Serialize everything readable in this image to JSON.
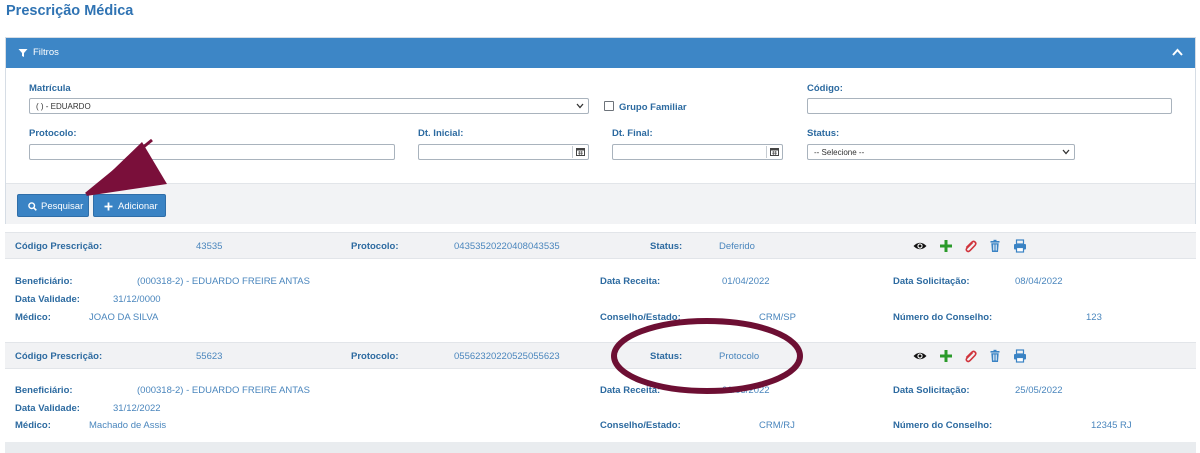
{
  "page": {
    "title": "Prescrição Médica"
  },
  "filters": {
    "title": "Filtros",
    "matricula": {
      "label": "Matrícula",
      "value": "(          ) - EDUARDO"
    },
    "grupo_familiar": {
      "label": "Grupo Familiar",
      "checked": false
    },
    "codigo": {
      "label": "Código:",
      "value": ""
    },
    "protocolo": {
      "label": "Protocolo:",
      "value": ""
    },
    "dt_inicial": {
      "label": "Dt. Inicial:",
      "value": ""
    },
    "dt_final": {
      "label": "Dt. Final:",
      "value": ""
    },
    "status": {
      "label": "Status:",
      "value": "-- Selecione --"
    }
  },
  "actions": {
    "search_label": "Pesquisar",
    "add_label": "Adicionar"
  },
  "prescriptions": [
    {
      "codigo_label": "Código Prescrição:",
      "codigo": "43535",
      "protocolo_label": "Protocolo:",
      "protocolo": "04353520220408043535",
      "status_label": "Status:",
      "status": "Deferido",
      "beneficiario_label": "Beneficiário:",
      "beneficiario": "(000318-2) - EDUARDO FREIRE ANTAS",
      "data_receita_label": "Data Receita:",
      "data_receita": "01/04/2022",
      "data_solicitacao_label": "Data Solicitação:",
      "data_solicitacao": "08/04/2022",
      "data_validade_label": "Data Validade:",
      "data_validade": "31/12/0000",
      "medico_label": "Médico:",
      "medico": "JOAO DA SILVA",
      "conselho_label": "Conselho/Estado:",
      "conselho": "CRM/SP",
      "numero_conselho_label": "Número do Conselho:",
      "numero_conselho": "123"
    },
    {
      "codigo_label": "Código Prescrição:",
      "codigo": "55623",
      "protocolo_label": "Protocolo:",
      "protocolo": "05562320220525055623",
      "status_label": "Status:",
      "status": "Protocolo",
      "beneficiario_label": "Beneficiário:",
      "beneficiario": "(000318-2) - EDUARDO FREIRE ANTAS",
      "data_receita_label": "Data Receita:",
      "data_receita": "01/05/2022",
      "data_solicitacao_label": "Data Solicitação:",
      "data_solicitacao": "25/05/2022",
      "data_validade_label": "Data Validade:",
      "data_validade": "31/12/2022",
      "medico_label": "Médico:",
      "medico": "Machado de Assis",
      "conselho_label": "Conselho/Estado:",
      "conselho": "CRM/RJ",
      "numero_conselho_label": "Número do Conselho:",
      "numero_conselho": "12345 RJ"
    }
  ],
  "icons": [
    "eye-icon",
    "plus-icon",
    "paperclip-icon",
    "trash-icon",
    "print-icon"
  ],
  "colors": {
    "primary": "#3d86c6",
    "annotation": "#7a0f3a",
    "plus": "#2a9a2a",
    "clip": "#d0343c"
  }
}
